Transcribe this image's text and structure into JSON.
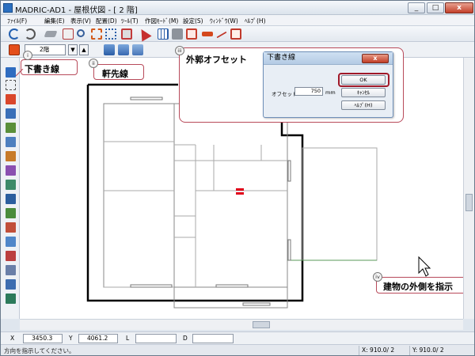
{
  "window": {
    "title": "MADRIC-AD1 - 屋根伏図 - [ 2 階]",
    "minimize": "_",
    "restore": "□",
    "close": "x"
  },
  "menu": [
    "ﾌｧｲﾙ(F)",
    "編集(E)",
    "表示(V)",
    "配置(D)",
    "ﾂｰﾙ(T)",
    "作図ﾓｰﾄﾞ(M)",
    "設定(S)",
    "ｳｨﾝﾄﾞｳ(W)",
    "ﾍﾙﾌﾟ(H)"
  ],
  "toolbar": {
    "icons": [
      "undo-icon",
      "redo-icon",
      "eraser-icon",
      "print-icon",
      "zoom-icon",
      "fit-icon",
      "expand-icon",
      "select-icon",
      "pointer-icon",
      "grid-icon",
      "snap-icon",
      "offset-rect-icon",
      "move-icon",
      "line-icon",
      "box-icon"
    ]
  },
  "floor_selector": {
    "value": "2階",
    "down_arrow": "▼",
    "up_arrow": "▲"
  },
  "callouts": {
    "i": {
      "badge": "i",
      "label": "下書き線"
    },
    "ii": {
      "badge": "ii",
      "label": "軒先線"
    },
    "iii": {
      "badge": "iii",
      "label": "外郭オフセット"
    },
    "iv": {
      "badge": "iv",
      "label": "建物の外側を指示"
    }
  },
  "dialog": {
    "title": "下書き線",
    "close": "x",
    "offset_label": "オフセット",
    "offset_value": "750",
    "unit": "mm",
    "ok": "OK",
    "cancel": "ｷｬﾝｾﾙ",
    "help": "ﾍﾙﾌﾟ(H)"
  },
  "coordinates": {
    "x_label": "X",
    "x_value": "3450.3",
    "y_label": "Y",
    "y_value": "4061.2",
    "l_label": "L",
    "d_label": "D"
  },
  "status": {
    "message": "方向を指示してください。",
    "x_grid": "X: 910.0/ 2",
    "y_grid": "Y: 910.0/ 2"
  }
}
